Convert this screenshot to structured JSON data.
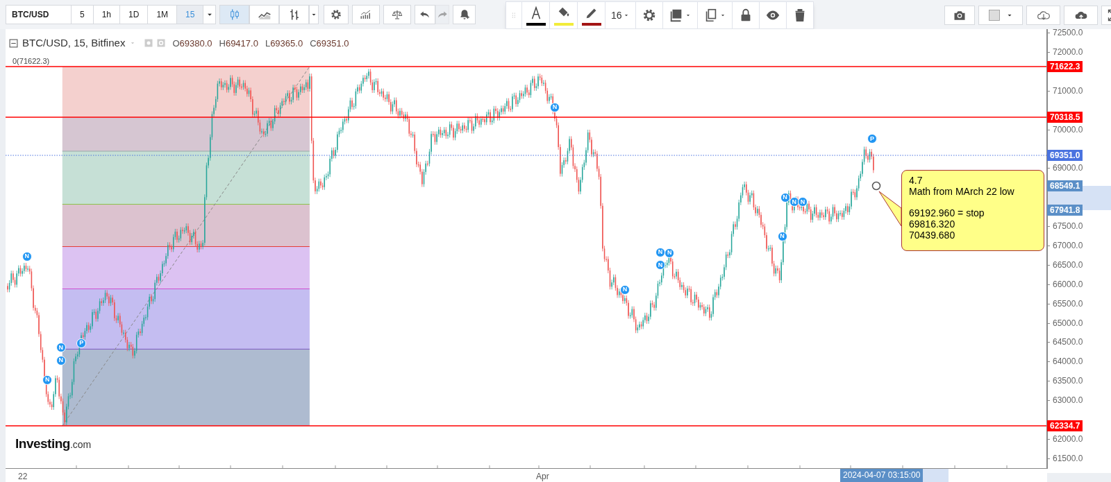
{
  "toolbar": {
    "symbol": "BTC/USD",
    "intervals": [
      {
        "label": "5",
        "selected": false
      },
      {
        "label": "1h",
        "selected": false
      },
      {
        "label": "1D",
        "selected": false
      },
      {
        "label": "1M",
        "selected": false
      },
      {
        "label": "15",
        "selected": true
      }
    ],
    "chart_types": [
      {
        "kind": "candles",
        "selected": true
      },
      {
        "kind": "line",
        "selected": false
      },
      {
        "kind": "bars",
        "selected": false
      }
    ],
    "tools": [
      {
        "kind": "settings",
        "disabled": false
      },
      {
        "kind": "indicators",
        "disabled": false
      },
      {
        "kind": "compare",
        "disabled": false
      },
      {
        "kind": "undo",
        "disabled": false
      },
      {
        "kind": "redo",
        "disabled": true
      },
      {
        "kind": "alert",
        "disabled": false
      }
    ]
  },
  "drawing_toolbar": [
    {
      "kind": "text-color",
      "color": "#000000"
    },
    {
      "kind": "fill-color",
      "color": "#f2ec3a"
    },
    {
      "kind": "line-color",
      "color": "#a31515"
    },
    {
      "kind": "font-size",
      "label": "16"
    },
    {
      "kind": "settings"
    },
    {
      "kind": "shadow"
    },
    {
      "kind": "clone"
    },
    {
      "kind": "lock"
    },
    {
      "kind": "visibility"
    },
    {
      "kind": "delete"
    }
  ],
  "right_toolbar": [
    {
      "kind": "screenshot"
    },
    {
      "kind": "color-swatch"
    },
    {
      "kind": "cloud-download"
    },
    {
      "kind": "cloud-upload"
    },
    {
      "kind": "fullscreen"
    }
  ],
  "legend": {
    "title": "BTC/USD, 15, Bitfinex",
    "ohlc": [
      {
        "key": "O",
        "value": "69380.0"
      },
      {
        "key": "H",
        "value": "69417.0"
      },
      {
        "key": "L",
        "value": "69365.0"
      },
      {
        "key": "C",
        "value": "69351.0"
      }
    ]
  },
  "fib_label": "0(71622.3)",
  "markers": [
    {
      "label": "N"
    },
    {
      "label": "N"
    },
    {
      "label": "N"
    },
    {
      "label": "N"
    },
    {
      "label": "P"
    },
    {
      "label": "N"
    },
    {
      "label": "N"
    },
    {
      "label": "N"
    },
    {
      "label": "N"
    },
    {
      "label": "N"
    },
    {
      "label": "N"
    },
    {
      "label": "N"
    },
    {
      "label": "N"
    },
    {
      "label": "N"
    },
    {
      "label": "P"
    }
  ],
  "callout": {
    "paragraphs": [
      "4.7\nMath from MArch 22 low",
      "69192.960 = stop\n69816.320\n70439.680"
    ]
  },
  "price_tags": [
    {
      "label": "71622.3",
      "kind": "horizontal-line",
      "color": "#ff0000"
    },
    {
      "label": "70318.5",
      "kind": "horizontal-line",
      "color": "#ff0000"
    },
    {
      "label": "69351.0",
      "kind": "current-price",
      "color": "#4a73e0"
    },
    {
      "label": "68549.1",
      "kind": "range-bound",
      "color": "#5b8fc7"
    },
    {
      "label": "67941.8",
      "kind": "range-bound",
      "color": "#5b8fc7"
    },
    {
      "label": "62334.7",
      "kind": "horizontal-line",
      "color": "#ff0000"
    }
  ],
  "y_ticks": [
    "72500.0",
    "72000.0",
    "71000.0",
    "70000.0",
    "69000.0",
    "67500.0",
    "67000.0",
    "66500.0",
    "66000.0",
    "65500.0",
    "65000.0",
    "64500.0",
    "64000.0",
    "63500.0",
    "63000.0",
    "62000.0",
    "61500.0"
  ],
  "x_labels": [
    "22",
    "Apr"
  ],
  "crosshair_time": "2024-04-07 03:15:00",
  "logo": {
    "brand": "Investing",
    "suffix": ".com"
  }
}
